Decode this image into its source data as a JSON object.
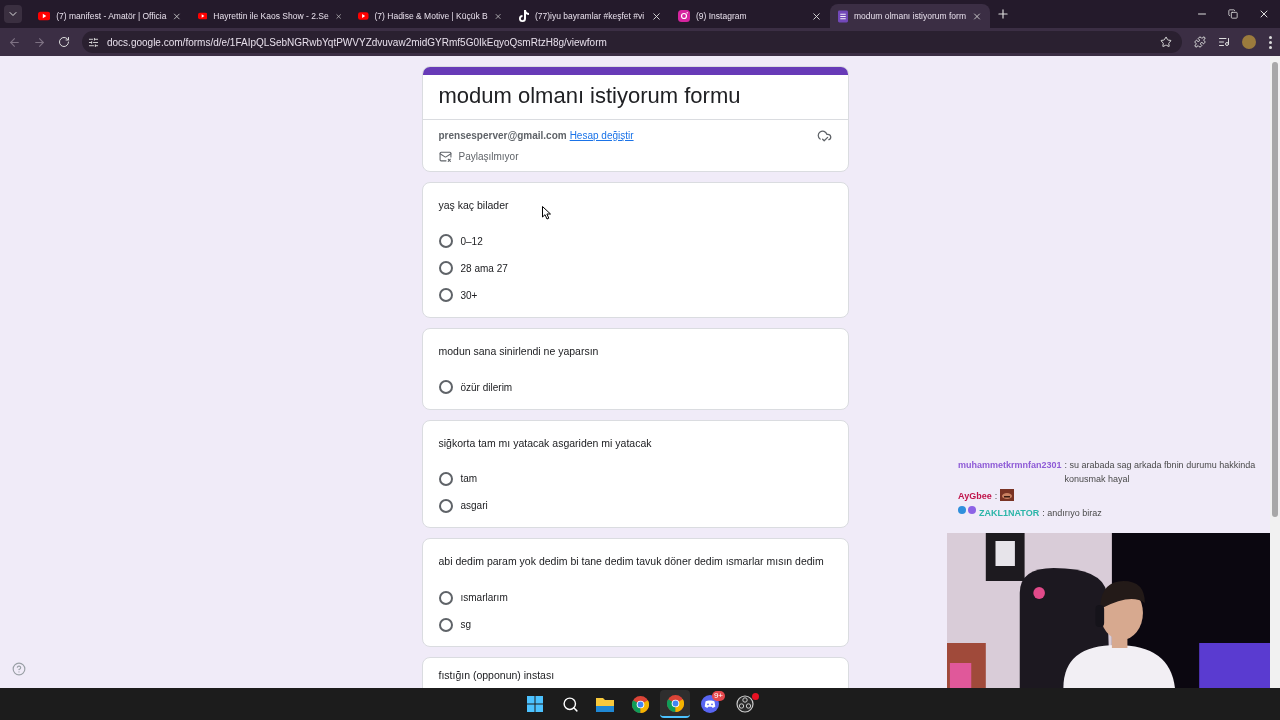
{
  "browser": {
    "tabs": [
      {
        "kind": "youtube",
        "title": "(7) manifest - Amatör | Officia",
        "selected": false
      },
      {
        "kind": "youtube",
        "title": "Hayrettin ile Kaos Show - 2.Se",
        "selected": false
      },
      {
        "kind": "youtube",
        "title": "(7) Hadise & Motive | Küçük B",
        "selected": false
      },
      {
        "kind": "tiktok",
        "title": "(77)iyu bayramlar #keşfet #vi",
        "selected": false
      },
      {
        "kind": "instagram",
        "title": "(9) Instagram",
        "selected": false
      },
      {
        "kind": "forms",
        "title": "modum olmanı istiyorum form",
        "selected": true
      }
    ],
    "url": "docs.google.com/forms/d/e/1FAIpQLSebNGRwbYqtPWVYZdvuvaw2midGYRmf5G0IkEqyoQsmRtzH8g/viewform"
  },
  "form": {
    "title": "modum olmanı istiyorum formu",
    "email": "prensesperver@gmail.com",
    "switch_account": "Hesap değiştir",
    "sharing": "Paylaşılmıyor",
    "questions": [
      {
        "text": "yaş kaç bilader",
        "options": [
          {
            "label": "0–12",
            "selected": false
          },
          {
            "label": "28 ama 27",
            "selected": false
          },
          {
            "label": "30+",
            "selected": false
          }
        ]
      },
      {
        "text": "modun sana sinirlendi ne yaparsın",
        "options": [
          {
            "label": "özür dilerim",
            "selected": false
          }
        ]
      },
      {
        "text": "siğkorta tam mı yatacak asgariden mi yatacak",
        "options": [
          {
            "label": "tam",
            "selected": false
          },
          {
            "label": "asgari",
            "selected": false
          }
        ]
      },
      {
        "text": "abi dedim param yok dedim bi tane dedim tavuk döner dedim ısmarlar mısın dedim",
        "options": [
          {
            "label": "ısmarlarım",
            "selected": false
          },
          {
            "label": "sg",
            "selected": false
          }
        ]
      },
      {
        "text": "fıstığın (opponun) instası"
      }
    ]
  },
  "chat": [
    {
      "user": "muhammetkrmnfan2301",
      "color": "#8e5bd6",
      "message": ": su arabada sag arkada fbnin durumu hakkinda konusmak hayal",
      "emote": false,
      "badges": false
    },
    {
      "user": "AyGbee",
      "color": "#c0144a",
      "message": ":",
      "emote": true,
      "badges": false
    },
    {
      "user": "ZAKL1NATOR",
      "color": "#2bb5a8",
      "message": ": andırıyo biraz",
      "emote": false,
      "badges": true
    }
  ],
  "taskbar": [
    {
      "kind": "start",
      "selected": false
    },
    {
      "kind": "search",
      "selected": false
    },
    {
      "kind": "folder",
      "selected": false
    },
    {
      "kind": "chrome",
      "selected": false
    },
    {
      "kind": "chrome",
      "selected": true
    },
    {
      "kind": "discord",
      "selected": false,
      "badge": "9+"
    },
    {
      "kind": "obs",
      "selected": false
    }
  ]
}
